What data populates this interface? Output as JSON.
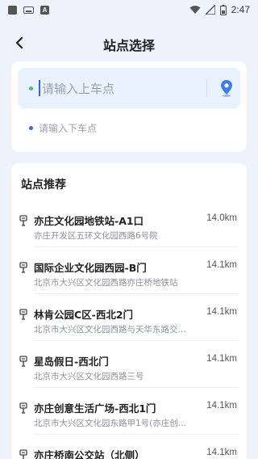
{
  "status_bar": {
    "time": "2:47",
    "notif_icon": "A"
  },
  "header": {
    "title": "站点选择",
    "back_icon": "chevron-left-icon"
  },
  "pickup": {
    "placeholder": "请输入上车点",
    "pin_icon": "location-pin-icon"
  },
  "dropoff": {
    "placeholder": "请输入下车点"
  },
  "section": {
    "title": "站点推荐"
  },
  "stations": [
    {
      "name": "亦庄文化园地铁站-A1口",
      "distance": "14.0km",
      "address": "亦庄开发区五环文化园西路6号院"
    },
    {
      "name": "国际企业文化园西园-B门",
      "distance": "14.1km",
      "address": "北京市大兴区文化园西路亦庄桥地铁站"
    },
    {
      "name": "林肯公园C区-西北2门",
      "distance": "14.1km",
      "address": "北京市大兴区文化园西路与天华东路交..."
    },
    {
      "name": "星岛假日-西北门",
      "distance": "14.1km",
      "address": "北京市大兴区文化园西路三号"
    },
    {
      "name": "亦庄创意生活广场-西北1门",
      "distance": "14.1km",
      "address": "北京市大兴区文化园东路甲1号(亦庄创..."
    },
    {
      "name": "亦庄桥南公交站（北侧）",
      "distance": "14.1km",
      "address": ""
    }
  ],
  "colors": {
    "accent": "#2f6be6",
    "pickup_dot": "#3ec17a",
    "dropoff_dot": "#2f6be6",
    "background": "#eef3fb"
  }
}
